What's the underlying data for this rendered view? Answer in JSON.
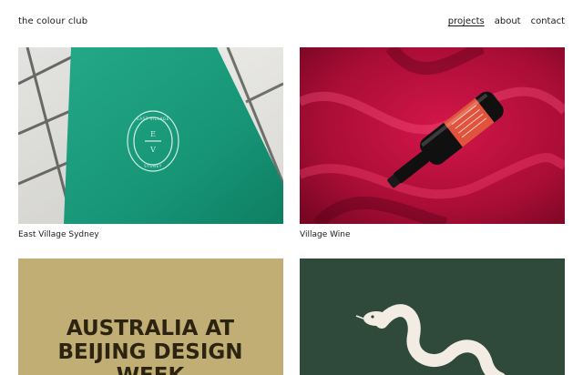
{
  "site": {
    "title": "the colour club"
  },
  "nav": {
    "items": [
      "projects",
      "about",
      "contact"
    ],
    "active": "projects"
  },
  "projects": [
    {
      "caption": "East Village Sydney",
      "logo_top": "EAST VILLAGE",
      "logo_bottom": "SYDNEY",
      "monogram_e": "E",
      "monogram_v": "V",
      "bg": "#1a9a7c"
    },
    {
      "caption": "Village Wine",
      "bg": "#b0103a"
    },
    {
      "caption": "",
      "headline_lines": [
        "AUSTRALIA AT",
        "BEIJING DESIGN",
        "WEEK"
      ],
      "bg": "#c1ae74"
    },
    {
      "caption": "",
      "bg": "#2f4a3b"
    }
  ]
}
